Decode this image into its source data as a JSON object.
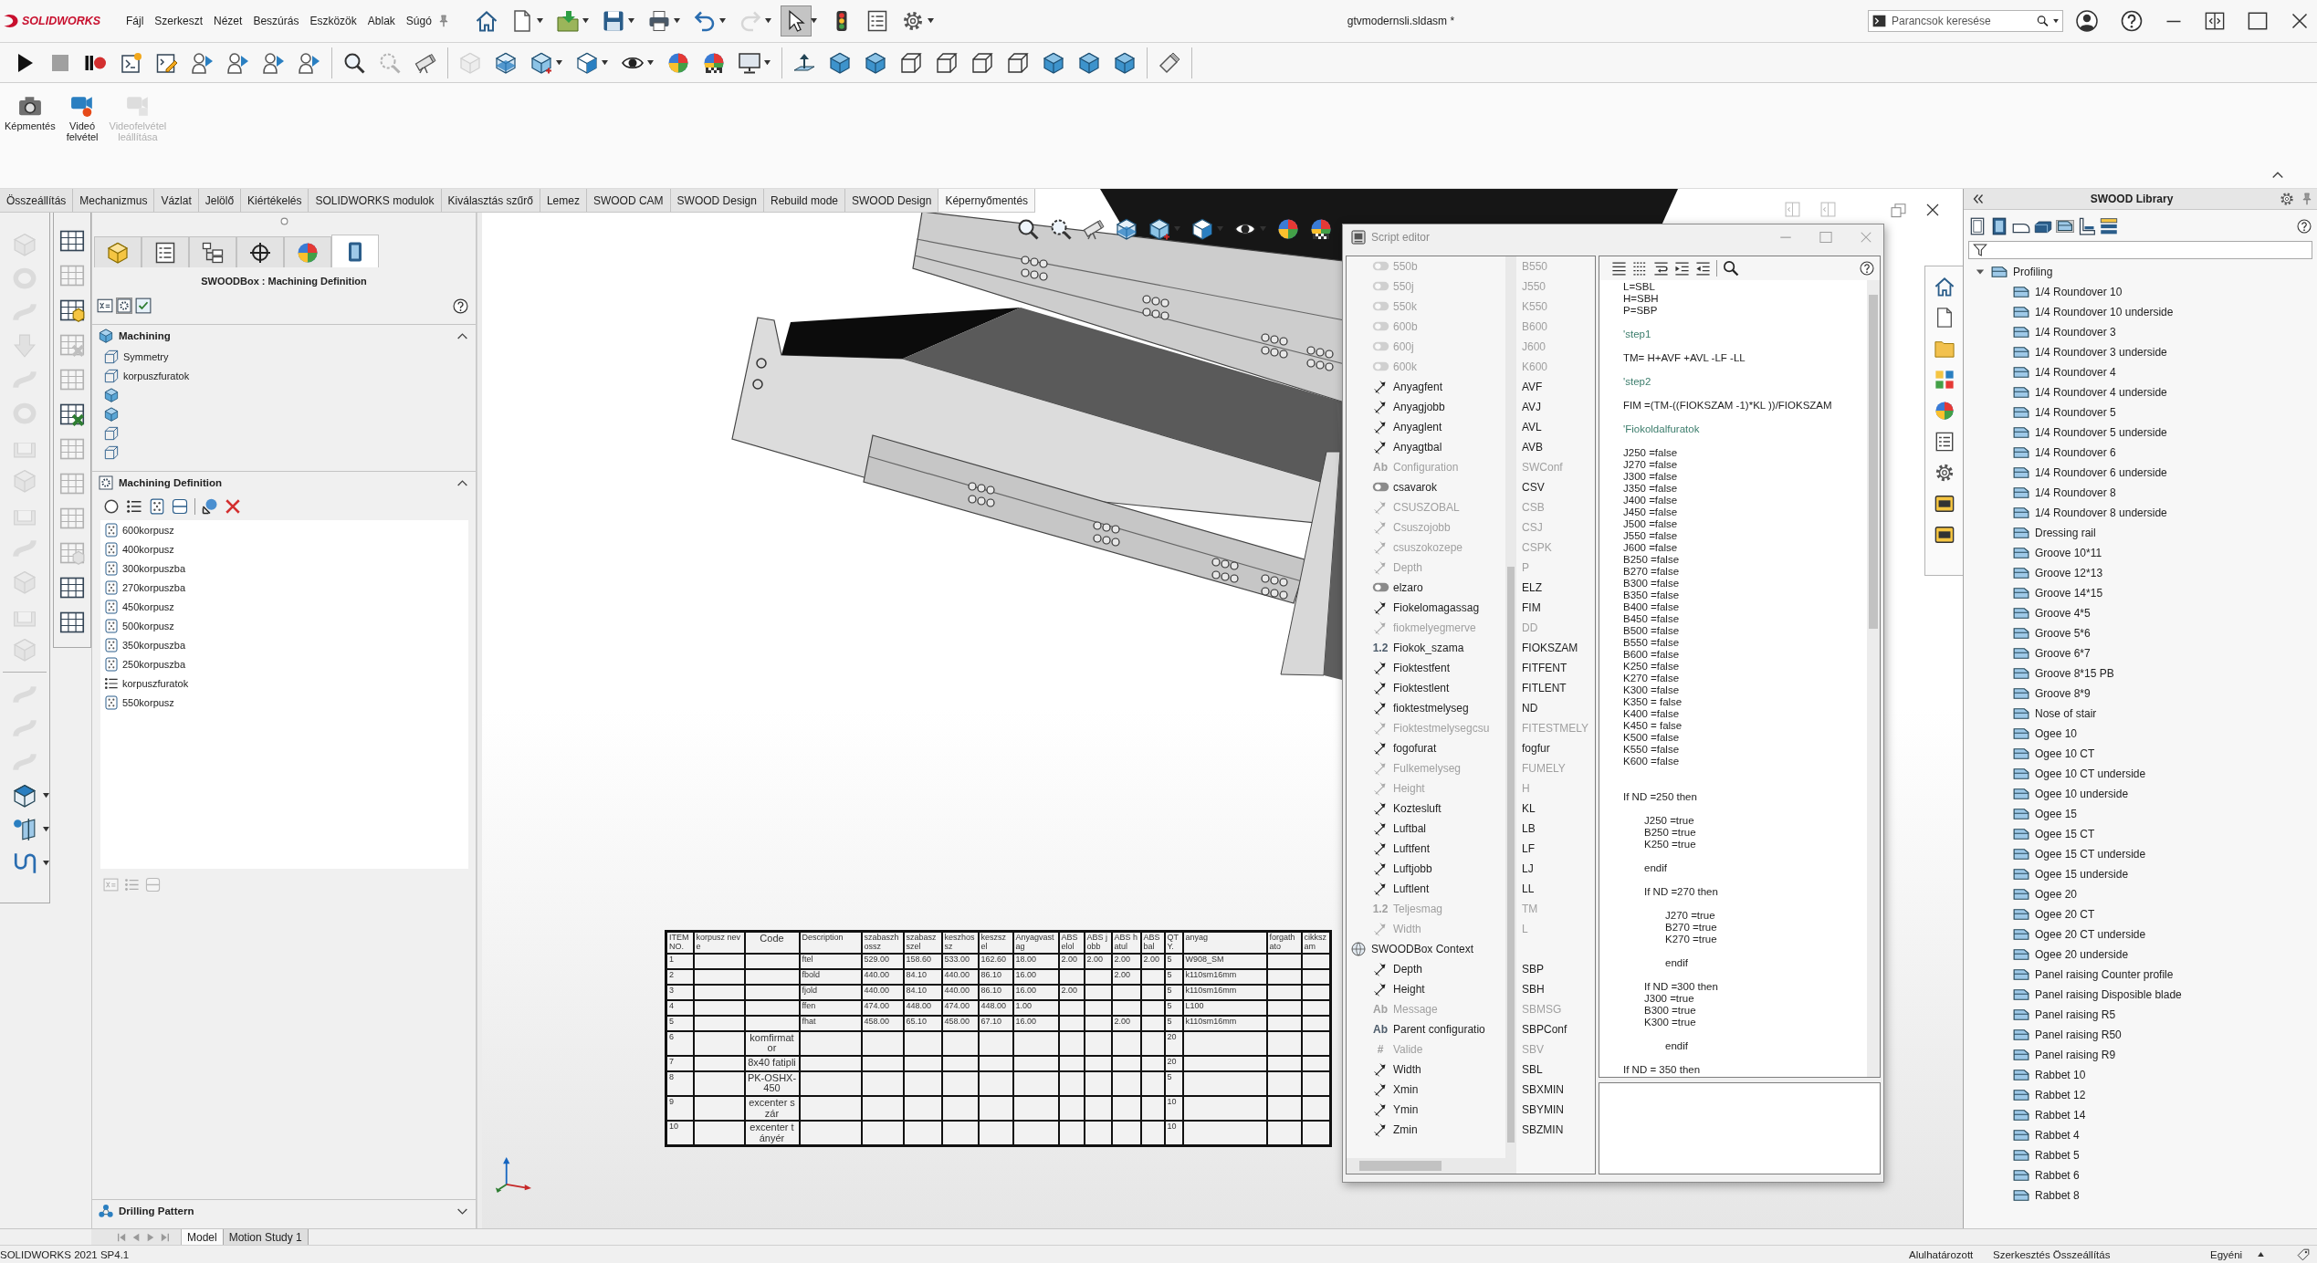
{
  "title_bar": {
    "logo_text": "SOLIDWORKS",
    "menu": [
      "Fájl",
      "Szerkeszt",
      "Nézet",
      "Beszúrás",
      "Eszközök",
      "Ablak",
      "Súgó"
    ],
    "quick_access": [
      {
        "kind": "home",
        "dropdown": false,
        "selected": false,
        "disabled": false
      },
      {
        "kind": "new",
        "dropdown": true,
        "selected": false,
        "disabled": false
      },
      {
        "kind": "open",
        "dropdown": true,
        "selected": false,
        "disabled": false
      },
      {
        "kind": "save",
        "dropdown": true,
        "selected": false,
        "disabled": false
      },
      {
        "kind": "print",
        "dropdown": true,
        "selected": false,
        "disabled": false
      },
      {
        "kind": "undo",
        "dropdown": true,
        "selected": false,
        "disabled": false
      },
      {
        "kind": "redo",
        "dropdown": true,
        "selected": false,
        "disabled": true
      },
      {
        "kind": "select",
        "dropdown": true,
        "selected": true,
        "disabled": false
      },
      {
        "kind": "rebuild",
        "dropdown": false,
        "selected": false,
        "disabled": false
      },
      {
        "kind": "properties",
        "dropdown": false,
        "selected": false,
        "disabled": false
      },
      {
        "kind": "options",
        "dropdown": true,
        "selected": false,
        "disabled": false
      }
    ],
    "document_title": "gtvmodernsli.sldasm *",
    "search": {
      "placeholder": "Parancsok keresése"
    }
  },
  "view_toolbar": [
    [
      {
        "kind": "play",
        "dropdown": false,
        "disabled": false
      },
      {
        "kind": "stop",
        "dropdown": false,
        "disabled": false
      },
      {
        "kind": "pause_record",
        "dropdown": false,
        "disabled": false
      },
      {
        "kind": "script_run",
        "dropdown": false,
        "disabled": false
      },
      {
        "kind": "script_edit",
        "dropdown": false,
        "disabled": false
      },
      {
        "kind": "person_arrow",
        "dropdown": false,
        "disabled": false
      },
      {
        "kind": "person_arrow",
        "dropdown": false,
        "disabled": false
      },
      {
        "kind": "person_arrow",
        "dropdown": false,
        "disabled": false
      },
      {
        "kind": "person_arrow",
        "dropdown": false,
        "disabled": false
      }
    ],
    [
      {
        "kind": "zoom_fit",
        "dropdown": false,
        "disabled": false
      },
      {
        "kind": "zoom_area",
        "dropdown": false,
        "disabled": true
      },
      {
        "kind": "previous_view",
        "dropdown": false,
        "disabled": false
      }
    ],
    [
      {
        "kind": "clip",
        "dropdown": false,
        "disabled": true
      },
      {
        "kind": "section",
        "dropdown": false,
        "disabled": false
      },
      {
        "kind": "orient",
        "dropdown": true,
        "disabled": false
      },
      {
        "kind": "display_style",
        "dropdown": true,
        "disabled": false
      },
      {
        "kind": "hide_show",
        "dropdown": true,
        "disabled": false
      },
      {
        "kind": "appearance",
        "dropdown": false,
        "disabled": false
      },
      {
        "kind": "scene",
        "dropdown": false,
        "disabled": false
      },
      {
        "kind": "view_settings",
        "dropdown": true,
        "disabled": false
      }
    ],
    [
      {
        "kind": "normal_to",
        "dropdown": false,
        "disabled": false
      },
      {
        "kind": "cube",
        "dropdown": false,
        "disabled": false
      },
      {
        "kind": "cube",
        "dropdown": false,
        "disabled": false
      },
      {
        "kind": "wire_cube",
        "dropdown": false,
        "disabled": false
      },
      {
        "kind": "wire_cube",
        "dropdown": false,
        "disabled": false
      },
      {
        "kind": "wire_cube",
        "dropdown": false,
        "disabled": false
      },
      {
        "kind": "wire_cube",
        "dropdown": false,
        "disabled": false
      },
      {
        "kind": "cube",
        "dropdown": false,
        "disabled": false
      },
      {
        "kind": "cube",
        "dropdown": false,
        "disabled": false
      },
      {
        "kind": "cube",
        "dropdown": false,
        "disabled": false
      }
    ],
    [
      {
        "kind": "flashlight",
        "dropdown": false,
        "disabled": false
      }
    ]
  ],
  "ribbon": {
    "buttons": [
      {
        "label": "Képmentés",
        "kind": "camera",
        "disabled": false
      },
      {
        "label": "Videó felvétel",
        "kind": "video",
        "disabled": false
      },
      {
        "label": "Videofelvétel leállítása",
        "kind": "video_stop",
        "disabled": true
      }
    ]
  },
  "command_tabs": [
    {
      "label": "Összeállítás",
      "selected": false
    },
    {
      "label": "Mechanizmus",
      "selected": false
    },
    {
      "label": "Vázlat",
      "selected": false
    },
    {
      "label": "Jelölő",
      "selected": false
    },
    {
      "label": "Kiértékelés",
      "selected": false
    },
    {
      "label": "SOLIDWORKS modulok",
      "selected": false
    },
    {
      "label": "Kiválasztás szűrő",
      "selected": false
    },
    {
      "label": "Lemez",
      "selected": false
    },
    {
      "label": "SWOOD CAM",
      "selected": false
    },
    {
      "label": "SWOOD Design",
      "selected": false
    },
    {
      "label": "Rebuild mode",
      "selected": false
    },
    {
      "label": "SWOOD Design",
      "selected": false
    },
    {
      "label": "Képernyőmentés",
      "selected": true
    }
  ],
  "feature_strip": [
    [
      {
        "kind": "extrude",
        "dropdown": false,
        "disabled": true
      },
      {
        "kind": "revolve",
        "dropdown": false,
        "disabled": true
      },
      {
        "kind": "sweep",
        "dropdown": false,
        "disabled": true
      },
      {
        "kind": "arrow_down",
        "dropdown": false,
        "disabled": true
      },
      {
        "kind": "sweep",
        "dropdown": false,
        "disabled": true
      },
      {
        "kind": "revolve",
        "dropdown": false,
        "disabled": true
      },
      {
        "kind": "shell",
        "dropdown": false,
        "disabled": true
      },
      {
        "kind": "extrude",
        "dropdown": false,
        "disabled": true
      },
      {
        "kind": "shell",
        "dropdown": false,
        "disabled": true
      },
      {
        "kind": "sweep",
        "dropdown": false,
        "disabled": true
      },
      {
        "kind": "extrude",
        "dropdown": false,
        "disabled": true
      },
      {
        "kind": "shell",
        "dropdown": false,
        "disabled": true
      },
      {
        "kind": "extrude",
        "dropdown": false,
        "disabled": true
      }
    ],
    [
      {
        "kind": "sweep",
        "dropdown": false,
        "disabled": true
      },
      {
        "kind": "sweep",
        "dropdown": false,
        "disabled": true
      },
      {
        "kind": "sweep",
        "dropdown": false,
        "disabled": true
      },
      {
        "kind": "box",
        "dropdown": true,
        "disabled": false
      },
      {
        "kind": "point",
        "dropdown": true,
        "disabled": false
      },
      {
        "kind": "curve",
        "dropdown": true,
        "disabled": false
      }
    ]
  ],
  "table_strip": [
    {
      "kind": "table",
      "disabled": false
    },
    {
      "kind": "table",
      "disabled": true
    },
    {
      "kind": "table_cube",
      "disabled": false
    },
    {
      "kind": "table_x",
      "disabled": true
    },
    {
      "kind": "table",
      "disabled": true
    },
    {
      "kind": "table_x",
      "disabled": false
    },
    {
      "kind": "table",
      "disabled": true
    },
    {
      "kind": "table",
      "disabled": true
    },
    {
      "kind": "table",
      "disabled": true
    },
    {
      "kind": "table_cube",
      "disabled": true
    },
    {
      "kind": "table",
      "disabled": false
    },
    {
      "kind": "table",
      "disabled": false
    }
  ],
  "property_manager": {
    "tabs": [
      {
        "kind": "feature_tree",
        "selected": false
      },
      {
        "kind": "property",
        "selected": false
      },
      {
        "kind": "configuration",
        "selected": false
      },
      {
        "kind": "crosshair",
        "selected": false
      },
      {
        "kind": "display",
        "selected": false
      },
      {
        "kind": "swood",
        "selected": true
      }
    ],
    "title": "SWOODBox : Machining Definition",
    "view_buttons": [
      {
        "kind": "variables",
        "selected": false
      },
      {
        "kind": "machining",
        "selected": true
      },
      {
        "kind": "checklist",
        "selected": false
      }
    ],
    "machining": {
      "title": "Machining",
      "expanded": true,
      "items": [
        {
          "label": "Symmetry",
          "kind": "wire"
        },
        {
          "label": "korpuszfuratok",
          "kind": "wire"
        },
        {
          "kind": "shaded"
        },
        {
          "kind": "shaded"
        },
        {
          "kind": "wire"
        },
        {
          "kind": "wire"
        }
      ]
    },
    "machining_definition": {
      "title": "Machining Definition",
      "expanded": true,
      "items": [
        {
          "label": "600korpusz",
          "kind": "pattern"
        },
        {
          "label": "400korpusz",
          "kind": "pattern"
        },
        {
          "label": "300korpuszba",
          "kind": "pattern"
        },
        {
          "label": "270korpuszba",
          "kind": "pattern"
        },
        {
          "label": "450korpusz",
          "kind": "pattern"
        },
        {
          "label": "500korpusz",
          "kind": "pattern"
        },
        {
          "label": "350korpuszba",
          "kind": "pattern"
        },
        {
          "label": "250korpuszba",
          "kind": "pattern"
        },
        {
          "label": "korpuszfuratok",
          "kind": "list"
        },
        {
          "label": "550korpusz",
          "kind": "pattern"
        }
      ]
    },
    "drilling_pattern": {
      "title": "Drilling Pattern",
      "expanded": false
    }
  },
  "bom_table": {
    "columns": [
      "ITEM NO.",
      "korpusz neve",
      "Code",
      "Description",
      "szabaszhossz",
      "szabaszszel",
      "keszhossz",
      "keszszel",
      "Anyagvastag",
      "ABS elol",
      "ABS jobb",
      "ABS hatul",
      "ABS bal",
      "QTY.",
      "anyag",
      "forgathato",
      "cikkszam"
    ],
    "rows": [
      [
        "1",
        null,
        null,
        "ftel",
        "529.00",
        "158.60",
        "533.00",
        "162.60",
        "18.00",
        "2.00",
        "2.00",
        "2.00",
        "2.00",
        "5",
        "W908_SM",
        null,
        null
      ],
      [
        "2",
        null,
        null,
        "fbold",
        "440.00",
        "84.10",
        "440.00",
        "86.10",
        "16.00",
        null,
        null,
        "2.00",
        null,
        "5",
        "k110sm16mm",
        null,
        null
      ],
      [
        "3",
        null,
        null,
        "fjold",
        "440.00",
        "84.10",
        "440.00",
        "86.10",
        "16.00",
        "2.00",
        null,
        null,
        null,
        "5",
        "k110sm16mm",
        null,
        null
      ],
      [
        "4",
        null,
        null,
        "ffen",
        "474.00",
        "448.00",
        "474.00",
        "448.00",
        "1.00",
        null,
        null,
        null,
        null,
        "5",
        "L100",
        null,
        null
      ],
      [
        "5",
        null,
        null,
        "fhat",
        "458.00",
        "65.10",
        "458.00",
        "67.10",
        "16.00",
        null,
        null,
        "2.00",
        null,
        "5",
        "k110sm16mm",
        null,
        null
      ],
      [
        "6",
        null,
        "komfirmator",
        null,
        null,
        null,
        null,
        null,
        null,
        null,
        null,
        null,
        null,
        "20",
        null,
        null,
        null
      ],
      [
        "7",
        null,
        "8x40 fatipli",
        null,
        null,
        null,
        null,
        null,
        null,
        null,
        null,
        null,
        null,
        "20",
        null,
        null,
        null
      ],
      [
        "8",
        null,
        "PK-OSHX-450",
        null,
        null,
        null,
        null,
        null,
        null,
        null,
        null,
        null,
        null,
        "5",
        null,
        null,
        null
      ],
      [
        "9",
        null,
        "excenter szár",
        null,
        null,
        null,
        null,
        null,
        null,
        null,
        null,
        null,
        null,
        "10",
        null,
        null,
        null
      ],
      [
        "10",
        null,
        "excenter tányér",
        null,
        null,
        null,
        null,
        null,
        null,
        null,
        null,
        null,
        null,
        "10",
        null,
        null,
        null
      ]
    ]
  },
  "script_editor": {
    "title": "Script editor",
    "variables": [
      {
        "name": "550b",
        "code": "B550",
        "kind": "boolean",
        "disabled": true
      },
      {
        "name": "550j",
        "code": "J550",
        "kind": "boolean",
        "disabled": true
      },
      {
        "name": "550k",
        "code": "K550",
        "kind": "boolean",
        "disabled": true
      },
      {
        "name": "600b",
        "code": "B600",
        "kind": "boolean",
        "disabled": true
      },
      {
        "name": "600j",
        "code": "J600",
        "kind": "boolean",
        "disabled": true
      },
      {
        "name": "600k",
        "code": "K600",
        "kind": "boolean",
        "disabled": true
      },
      {
        "name": "Anyagfent",
        "code": "AVF",
        "kind": "dimension",
        "disabled": false
      },
      {
        "name": "Anyagjobb",
        "code": "AVJ",
        "kind": "dimension",
        "disabled": false
      },
      {
        "name": "Anyaglent",
        "code": "AVL",
        "kind": "dimension",
        "disabled": false
      },
      {
        "name": "Anyagtbal",
        "code": "AVB",
        "kind": "dimension",
        "disabled": false
      },
      {
        "name": "Configuration",
        "code": "SWConf",
        "kind": "text",
        "symbol": "Ab",
        "disabled": true
      },
      {
        "name": "csavarok",
        "code": "CSV",
        "kind": "boolean",
        "disabled": false
      },
      {
        "name": "CSUSZOBAL",
        "code": "CSB",
        "kind": "dimension",
        "disabled": true
      },
      {
        "name": "Csuszojobb",
        "code": "CSJ",
        "kind": "dimension",
        "disabled": true
      },
      {
        "name": "csuszokozepe",
        "code": "CSPK",
        "kind": "dimension",
        "disabled": true
      },
      {
        "name": "Depth",
        "code": "P",
        "kind": "dimension",
        "disabled": true
      },
      {
        "name": "elzaro",
        "code": "ELZ",
        "kind": "boolean",
        "disabled": false
      },
      {
        "name": "Fiokelomagassag",
        "code": "FIM",
        "kind": "dimension",
        "disabled": false
      },
      {
        "name": "fiokmelyegmerve",
        "code": "DD",
        "kind": "dimension",
        "disabled": true
      },
      {
        "name": "Fiokok_szama",
        "code": "FIOKSZAM",
        "kind": "number",
        "symbol": "1.2",
        "disabled": false
      },
      {
        "name": "Fioktestfent",
        "code": "FITFENT",
        "kind": "dimension",
        "disabled": false
      },
      {
        "name": "Fioktestlent",
        "code": "FITLENT",
        "kind": "dimension",
        "disabled": false
      },
      {
        "name": "fioktestmelyseg",
        "code": "ND",
        "kind": "dimension",
        "disabled": false
      },
      {
        "name": "Fioktestmelysegcsu",
        "code": "FITESTMELY",
        "kind": "dimension",
        "disabled": true
      },
      {
        "name": "fogofurat",
        "code": "fogfur",
        "kind": "dimension",
        "disabled": false
      },
      {
        "name": "Fulkemelyseg",
        "code": "FUMELY",
        "kind": "dimension",
        "disabled": true
      },
      {
        "name": "Height",
        "code": "H",
        "kind": "dimension",
        "disabled": true
      },
      {
        "name": "Koztesluft",
        "code": "KL",
        "kind": "dimension",
        "disabled": false
      },
      {
        "name": "Luftbal",
        "code": "LB",
        "kind": "dimension",
        "disabled": false
      },
      {
        "name": "Luftfent",
        "code": "LF",
        "kind": "dimension",
        "disabled": false
      },
      {
        "name": "Luftjobb",
        "code": "LJ",
        "kind": "dimension",
        "disabled": false
      },
      {
        "name": "Luftlent",
        "code": "LL",
        "kind": "dimension",
        "disabled": false
      },
      {
        "name": "Teljesmag",
        "code": "TM",
        "kind": "number",
        "symbol": "1.2",
        "disabled": true
      },
      {
        "name": "Width",
        "code": "L",
        "kind": "dimension",
        "disabled": true
      },
      {
        "name": "SWOODBox Context",
        "kind": "context",
        "children": [
          {
            "name": "Depth",
            "code": "SBP",
            "kind": "dimension",
            "disabled": false
          },
          {
            "name": "Height",
            "code": "SBH",
            "kind": "dimension",
            "disabled": false
          },
          {
            "name": "Message",
            "code": "SBMSG",
            "kind": "text",
            "symbol": "Ab",
            "disabled": true
          },
          {
            "name": "Parent configuratio",
            "code": "SBPConf",
            "kind": "text",
            "symbol": "Ab",
            "disabled": false
          },
          {
            "name": "Valide",
            "code": "SBV",
            "kind": "integer",
            "symbol": "#",
            "disabled": true
          },
          {
            "name": "Width",
            "code": "SBL",
            "kind": "dimension",
            "disabled": false
          },
          {
            "name": "Xmin",
            "code": "SBXMIN",
            "kind": "dimension",
            "disabled": false
          },
          {
            "name": "Ymin",
            "code": "SBYMIN",
            "kind": "dimension",
            "disabled": false
          },
          {
            "name": "Zmin",
            "code": "SBZMIN",
            "kind": "dimension",
            "disabled": false
          }
        ]
      }
    ],
    "code_lines": [
      {
        "kind": "code",
        "text": "L=SBL"
      },
      {
        "kind": "code",
        "text": "H=SBH"
      },
      {
        "kind": "code",
        "text": "P=SBP"
      },
      {
        "kind": "blank"
      },
      {
        "kind": "comment",
        "text": "'step1"
      },
      {
        "kind": "blank"
      },
      {
        "kind": "code",
        "text": "TM= H+AVF +AVL -LF -LL"
      },
      {
        "kind": "blank"
      },
      {
        "kind": "comment",
        "text": "'step2"
      },
      {
        "kind": "blank"
      },
      {
        "kind": "code",
        "text": "FIM =(TM-((FIOKSZAM -1)*KL ))/FIOKSZAM"
      },
      {
        "kind": "blank"
      },
      {
        "kind": "comment",
        "text": "'Fiokoldalfuratok"
      },
      {
        "kind": "blank"
      },
      {
        "kind": "code",
        "text": "J250 =false"
      },
      {
        "kind": "code",
        "text": "J270 =false"
      },
      {
        "kind": "code",
        "text": "J300 =false"
      },
      {
        "kind": "code",
        "text": "J350 =false"
      },
      {
        "kind": "code",
        "text": "J400 =false"
      },
      {
        "kind": "code",
        "text": "J450 =false"
      },
      {
        "kind": "code",
        "text": "J500 =false"
      },
      {
        "kind": "code",
        "text": "J550 =false"
      },
      {
        "kind": "code",
        "text": "J600 =false"
      },
      {
        "kind": "code",
        "text": "B250 =false"
      },
      {
        "kind": "code",
        "text": "B270 =false"
      },
      {
        "kind": "code",
        "text": "B300 =false"
      },
      {
        "kind": "code",
        "text": "B350 =false"
      },
      {
        "kind": "code",
        "text": "B400 =false"
      },
      {
        "kind": "code",
        "text": "B450 =false"
      },
      {
        "kind": "code",
        "text": "B500 =false"
      },
      {
        "kind": "code",
        "text": "B550 =false"
      },
      {
        "kind": "code",
        "text": "B600 =false"
      },
      {
        "kind": "code",
        "text": "K250 =false"
      },
      {
        "kind": "code",
        "text": "K270 =false"
      },
      {
        "kind": "code",
        "text": "K300 =false"
      },
      {
        "kind": "code",
        "text": "K350 = false"
      },
      {
        "kind": "code",
        "text": "K400 =false"
      },
      {
        "kind": "code",
        "text": "K450 = false"
      },
      {
        "kind": "code",
        "text": "K500 =false"
      },
      {
        "kind": "code",
        "text": "K550 =false"
      },
      {
        "kind": "code",
        "text": "K600 =false"
      },
      {
        "kind": "blank"
      },
      {
        "kind": "blank"
      },
      {
        "kind": "code",
        "text": "If ND =250 then"
      },
      {
        "kind": "indent",
        "children": [
          {
            "kind": "blank"
          },
          {
            "kind": "code",
            "text": "J250 =true"
          },
          {
            "kind": "code",
            "text": "B250 =true"
          },
          {
            "kind": "code",
            "text": "K250 =true"
          },
          {
            "kind": "blank"
          },
          {
            "kind": "code",
            "text": "endif"
          },
          {
            "kind": "blank"
          },
          {
            "kind": "code",
            "text": "If ND =270 then"
          },
          {
            "kind": "indent",
            "children": [
              {
                "kind": "blank"
              },
              {
                "kind": "code",
                "text": "J270 =true"
              },
              {
                "kind": "code",
                "text": "B270 =true"
              },
              {
                "kind": "code",
                "text": "K270 =true"
              },
              {
                "kind": "blank"
              },
              {
                "kind": "code",
                "text": "endif"
              }
            ]
          },
          {
            "kind": "blank"
          },
          {
            "kind": "code",
            "text": "If ND =300 then"
          },
          {
            "kind": "code",
            "text": "J300 =true"
          },
          {
            "kind": "code",
            "text": "B300 =true"
          },
          {
            "kind": "code",
            "text": "K300 =true"
          },
          {
            "kind": "blank"
          },
          {
            "kind": "indent",
            "children": [
              {
                "kind": "code",
                "text": "endif"
              }
            ]
          }
        ]
      },
      {
        "kind": "blank"
      },
      {
        "kind": "code",
        "text": "If ND = 350 then"
      }
    ]
  },
  "swood_library": {
    "title": "SWOOD Library",
    "tabs": [
      {
        "kind": "frame",
        "selected": false
      },
      {
        "kind": "panel",
        "selected": false
      },
      {
        "kind": "edge",
        "selected": false
      },
      {
        "kind": "block",
        "selected": false
      },
      {
        "kind": "profile",
        "selected": true
      },
      {
        "kind": "corner",
        "selected": false
      },
      {
        "kind": "stack",
        "selected": false
      }
    ],
    "tree": [
      {
        "label": "Profiling",
        "expanded": true,
        "children": [
          {
            "label": "1/4 Roundover 10"
          },
          {
            "label": "1/4 Roundover 10 underside"
          },
          {
            "label": "1/4 Roundover 3"
          },
          {
            "label": "1/4 Roundover 3 underside"
          },
          {
            "label": "1/4 Roundover 4"
          },
          {
            "label": "1/4 Roundover 4 underside"
          },
          {
            "label": "1/4 Roundover 5"
          },
          {
            "label": "1/4 Roundover 5 underside"
          },
          {
            "label": "1/4 Roundover 6"
          },
          {
            "label": "1/4 Roundover 6 underside"
          },
          {
            "label": "1/4 Roundover 8"
          },
          {
            "label": "1/4 Roundover 8 underside"
          },
          {
            "label": "Dressing rail"
          },
          {
            "label": "Groove 10*11"
          },
          {
            "label": "Groove 12*13"
          },
          {
            "label": "Groove 14*15"
          },
          {
            "label": "Groove 4*5"
          },
          {
            "label": "Groove 5*6"
          },
          {
            "label": "Groove 6*7"
          },
          {
            "label": "Groove 8*15 PB"
          },
          {
            "label": "Groove 8*9"
          },
          {
            "label": "Nose of stair"
          },
          {
            "label": "Ogee 10"
          },
          {
            "label": "Ogee 10 CT"
          },
          {
            "label": "Ogee 10 CT underside"
          },
          {
            "label": "Ogee 10 underside"
          },
          {
            "label": "Ogee 15"
          },
          {
            "label": "Ogee 15 CT"
          },
          {
            "label": "Ogee 15 CT underside"
          },
          {
            "label": "Ogee 15 underside"
          },
          {
            "label": "Ogee 20"
          },
          {
            "label": "Ogee 20 CT"
          },
          {
            "label": "Ogee 20 CT underside"
          },
          {
            "label": "Ogee 20 underside"
          },
          {
            "label": "Panel raising Counter profile"
          },
          {
            "label": "Panel raising Disposible blade"
          },
          {
            "label": "Panel raising R5"
          },
          {
            "label": "Panel raising R50"
          },
          {
            "label": "Panel raising R9"
          },
          {
            "label": "Rabbet 10"
          },
          {
            "label": "Rabbet 12"
          },
          {
            "label": "Rabbet 14"
          },
          {
            "label": "Rabbet 4"
          },
          {
            "label": "Rabbet 5"
          },
          {
            "label": "Rabbet 6"
          },
          {
            "label": "Rabbet 8"
          }
        ]
      }
    ]
  },
  "bottom_tabs": [
    {
      "label": "Model",
      "selected": true
    },
    {
      "label": "Motion Study 1",
      "selected": false
    }
  ],
  "status_bar": {
    "version": "SOLIDWORKS 2021 SP4.1",
    "state": "Alulhatározott",
    "mode": "Szerkesztés Összeállítás",
    "units": "Egyéni"
  }
}
